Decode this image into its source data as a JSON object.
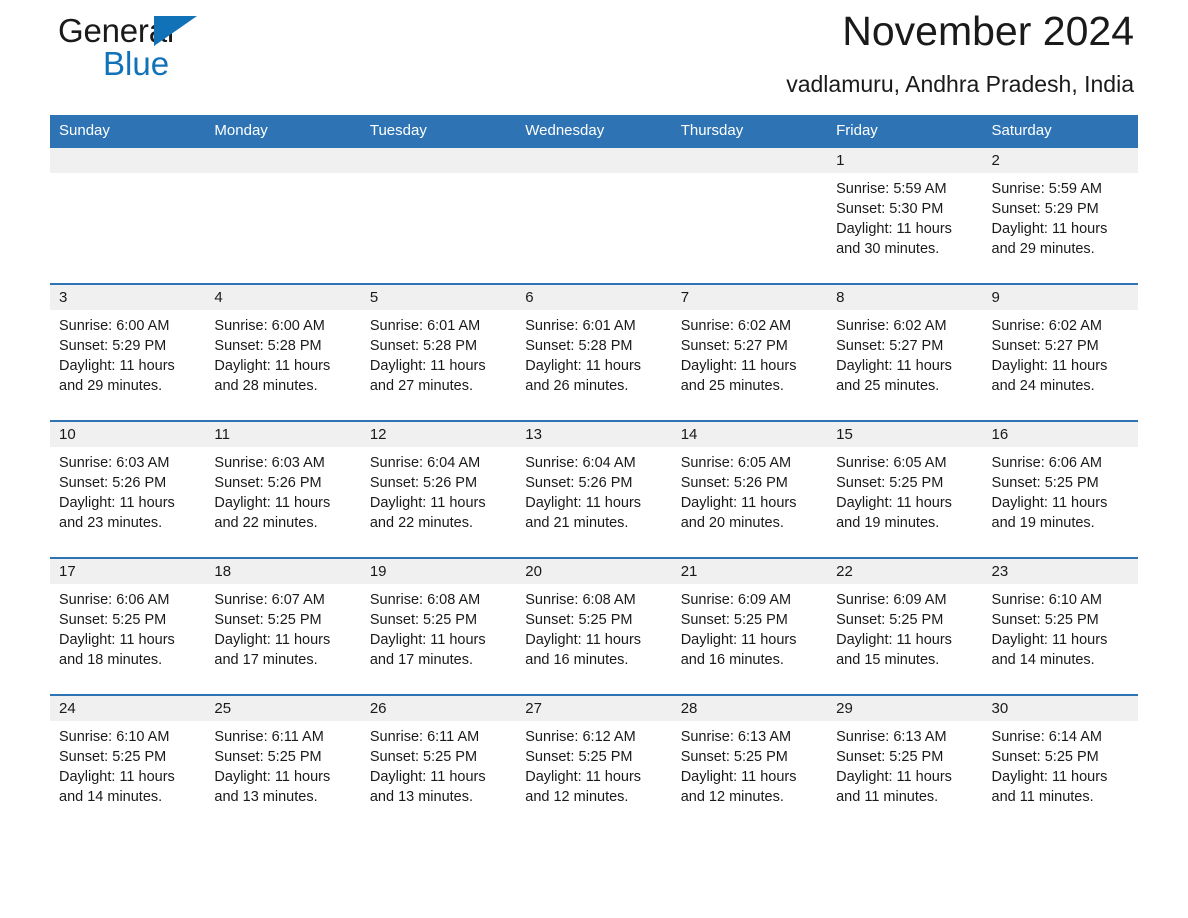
{
  "logo": {
    "text_top": "General",
    "text_bottom": "Blue",
    "triangle": "blue-triangle-icon",
    "accent_color": "#1272b8"
  },
  "header": {
    "month_title": "November 2024",
    "location": "vadlamuru, Andhra Pradesh, India"
  },
  "colors": {
    "header_blue": "#2e74b5",
    "date_band_gray": "#f0f0f0",
    "text": "#1a1a1a"
  },
  "calendar": {
    "weekday_headers": [
      "Sunday",
      "Monday",
      "Tuesday",
      "Wednesday",
      "Thursday",
      "Friday",
      "Saturday"
    ],
    "weeks": [
      [
        {
          "date": "",
          "empty": true
        },
        {
          "date": "",
          "empty": true
        },
        {
          "date": "",
          "empty": true
        },
        {
          "date": "",
          "empty": true
        },
        {
          "date": "",
          "empty": true
        },
        {
          "date": "1",
          "sunrise": "Sunrise: 5:59 AM",
          "sunset": "Sunset: 5:30 PM",
          "daylight_line1": "Daylight: 11 hours",
          "daylight_line2": "and 30 minutes."
        },
        {
          "date": "2",
          "sunrise": "Sunrise: 5:59 AM",
          "sunset": "Sunset: 5:29 PM",
          "daylight_line1": "Daylight: 11 hours",
          "daylight_line2": "and 29 minutes."
        }
      ],
      [
        {
          "date": "3",
          "sunrise": "Sunrise: 6:00 AM",
          "sunset": "Sunset: 5:29 PM",
          "daylight_line1": "Daylight: 11 hours",
          "daylight_line2": "and 29 minutes."
        },
        {
          "date": "4",
          "sunrise": "Sunrise: 6:00 AM",
          "sunset": "Sunset: 5:28 PM",
          "daylight_line1": "Daylight: 11 hours",
          "daylight_line2": "and 28 minutes."
        },
        {
          "date": "5",
          "sunrise": "Sunrise: 6:01 AM",
          "sunset": "Sunset: 5:28 PM",
          "daylight_line1": "Daylight: 11 hours",
          "daylight_line2": "and 27 minutes."
        },
        {
          "date": "6",
          "sunrise": "Sunrise: 6:01 AM",
          "sunset": "Sunset: 5:28 PM",
          "daylight_line1": "Daylight: 11 hours",
          "daylight_line2": "and 26 minutes."
        },
        {
          "date": "7",
          "sunrise": "Sunrise: 6:02 AM",
          "sunset": "Sunset: 5:27 PM",
          "daylight_line1": "Daylight: 11 hours",
          "daylight_line2": "and 25 minutes."
        },
        {
          "date": "8",
          "sunrise": "Sunrise: 6:02 AM",
          "sunset": "Sunset: 5:27 PM",
          "daylight_line1": "Daylight: 11 hours",
          "daylight_line2": "and 25 minutes."
        },
        {
          "date": "9",
          "sunrise": "Sunrise: 6:02 AM",
          "sunset": "Sunset: 5:27 PM",
          "daylight_line1": "Daylight: 11 hours",
          "daylight_line2": "and 24 minutes."
        }
      ],
      [
        {
          "date": "10",
          "sunrise": "Sunrise: 6:03 AM",
          "sunset": "Sunset: 5:26 PM",
          "daylight_line1": "Daylight: 11 hours",
          "daylight_line2": "and 23 minutes."
        },
        {
          "date": "11",
          "sunrise": "Sunrise: 6:03 AM",
          "sunset": "Sunset: 5:26 PM",
          "daylight_line1": "Daylight: 11 hours",
          "daylight_line2": "and 22 minutes."
        },
        {
          "date": "12",
          "sunrise": "Sunrise: 6:04 AM",
          "sunset": "Sunset: 5:26 PM",
          "daylight_line1": "Daylight: 11 hours",
          "daylight_line2": "and 22 minutes."
        },
        {
          "date": "13",
          "sunrise": "Sunrise: 6:04 AM",
          "sunset": "Sunset: 5:26 PM",
          "daylight_line1": "Daylight: 11 hours",
          "daylight_line2": "and 21 minutes."
        },
        {
          "date": "14",
          "sunrise": "Sunrise: 6:05 AM",
          "sunset": "Sunset: 5:26 PM",
          "daylight_line1": "Daylight: 11 hours",
          "daylight_line2": "and 20 minutes."
        },
        {
          "date": "15",
          "sunrise": "Sunrise: 6:05 AM",
          "sunset": "Sunset: 5:25 PM",
          "daylight_line1": "Daylight: 11 hours",
          "daylight_line2": "and 19 minutes."
        },
        {
          "date": "16",
          "sunrise": "Sunrise: 6:06 AM",
          "sunset": "Sunset: 5:25 PM",
          "daylight_line1": "Daylight: 11 hours",
          "daylight_line2": "and 19 minutes."
        }
      ],
      [
        {
          "date": "17",
          "sunrise": "Sunrise: 6:06 AM",
          "sunset": "Sunset: 5:25 PM",
          "daylight_line1": "Daylight: 11 hours",
          "daylight_line2": "and 18 minutes."
        },
        {
          "date": "18",
          "sunrise": "Sunrise: 6:07 AM",
          "sunset": "Sunset: 5:25 PM",
          "daylight_line1": "Daylight: 11 hours",
          "daylight_line2": "and 17 minutes."
        },
        {
          "date": "19",
          "sunrise": "Sunrise: 6:08 AM",
          "sunset": "Sunset: 5:25 PM",
          "daylight_line1": "Daylight: 11 hours",
          "daylight_line2": "and 17 minutes."
        },
        {
          "date": "20",
          "sunrise": "Sunrise: 6:08 AM",
          "sunset": "Sunset: 5:25 PM",
          "daylight_line1": "Daylight: 11 hours",
          "daylight_line2": "and 16 minutes."
        },
        {
          "date": "21",
          "sunrise": "Sunrise: 6:09 AM",
          "sunset": "Sunset: 5:25 PM",
          "daylight_line1": "Daylight: 11 hours",
          "daylight_line2": "and 16 minutes."
        },
        {
          "date": "22",
          "sunrise": "Sunrise: 6:09 AM",
          "sunset": "Sunset: 5:25 PM",
          "daylight_line1": "Daylight: 11 hours",
          "daylight_line2": "and 15 minutes."
        },
        {
          "date": "23",
          "sunrise": "Sunrise: 6:10 AM",
          "sunset": "Sunset: 5:25 PM",
          "daylight_line1": "Daylight: 11 hours",
          "daylight_line2": "and 14 minutes."
        }
      ],
      [
        {
          "date": "24",
          "sunrise": "Sunrise: 6:10 AM",
          "sunset": "Sunset: 5:25 PM",
          "daylight_line1": "Daylight: 11 hours",
          "daylight_line2": "and 14 minutes."
        },
        {
          "date": "25",
          "sunrise": "Sunrise: 6:11 AM",
          "sunset": "Sunset: 5:25 PM",
          "daylight_line1": "Daylight: 11 hours",
          "daylight_line2": "and 13 minutes."
        },
        {
          "date": "26",
          "sunrise": "Sunrise: 6:11 AM",
          "sunset": "Sunset: 5:25 PM",
          "daylight_line1": "Daylight: 11 hours",
          "daylight_line2": "and 13 minutes."
        },
        {
          "date": "27",
          "sunrise": "Sunrise: 6:12 AM",
          "sunset": "Sunset: 5:25 PM",
          "daylight_line1": "Daylight: 11 hours",
          "daylight_line2": "and 12 minutes."
        },
        {
          "date": "28",
          "sunrise": "Sunrise: 6:13 AM",
          "sunset": "Sunset: 5:25 PM",
          "daylight_line1": "Daylight: 11 hours",
          "daylight_line2": "and 12 minutes."
        },
        {
          "date": "29",
          "sunrise": "Sunrise: 6:13 AM",
          "sunset": "Sunset: 5:25 PM",
          "daylight_line1": "Daylight: 11 hours",
          "daylight_line2": "and 11 minutes."
        },
        {
          "date": "30",
          "sunrise": "Sunrise: 6:14 AM",
          "sunset": "Sunset: 5:25 PM",
          "daylight_line1": "Daylight: 11 hours",
          "daylight_line2": "and 11 minutes."
        }
      ]
    ]
  }
}
